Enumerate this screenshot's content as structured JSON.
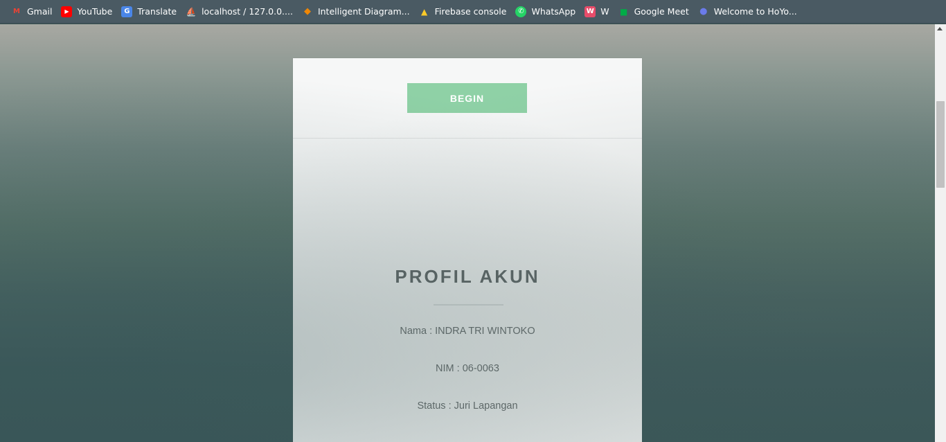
{
  "bookmarks": [
    {
      "label": "Gmail",
      "icon": "gmail-icon",
      "glyph": "M",
      "color": "#ea4335",
      "bg": "transparent"
    },
    {
      "label": "YouTube",
      "icon": "youtube-icon",
      "glyph": "▶",
      "color": "#ffffff",
      "bg": "#ff0000"
    },
    {
      "label": "Translate",
      "icon": "google-translate-icon",
      "glyph": "G",
      "color": "#ffffff",
      "bg": "#4a86e8"
    },
    {
      "label": "localhost / 127.0.0....",
      "icon": "phpmyadmin-icon",
      "glyph": "⛵",
      "color": "#f0a030",
      "bg": "transparent"
    },
    {
      "label": "Intelligent Diagram...",
      "icon": "drawio-icon",
      "glyph": "◆",
      "color": "#f08705",
      "bg": "transparent"
    },
    {
      "label": "Firebase console",
      "icon": "firebase-icon",
      "glyph": "▲",
      "color": "#ffca28",
      "bg": "transparent"
    },
    {
      "label": "WhatsApp",
      "icon": "whatsapp-icon",
      "glyph": "✆",
      "color": "#ffffff",
      "bg": "#25d366"
    },
    {
      "label": "W",
      "icon": "w-app-icon",
      "glyph": "W",
      "color": "#ffffff",
      "bg": "#e84c6a"
    },
    {
      "label": "Google Meet",
      "icon": "google-meet-icon",
      "glyph": "■",
      "color": "#00ac47",
      "bg": "transparent"
    },
    {
      "label": "Welcome to HoYo...",
      "icon": "hoyolab-icon",
      "glyph": "●",
      "color": "#6b7bea",
      "bg": "transparent"
    }
  ],
  "card": {
    "begin_label": "BEGIN",
    "title": "PROFIL AKUN",
    "nama": "Nama : INDRA TRI WINTOKO",
    "nim": "NIM : 06-0063",
    "status": "Status : Juri Lapangan"
  },
  "colors": {
    "begin_button": "#8fd1a6",
    "title": "#5f6566",
    "bookmarks_bar": "#4a5a63"
  }
}
